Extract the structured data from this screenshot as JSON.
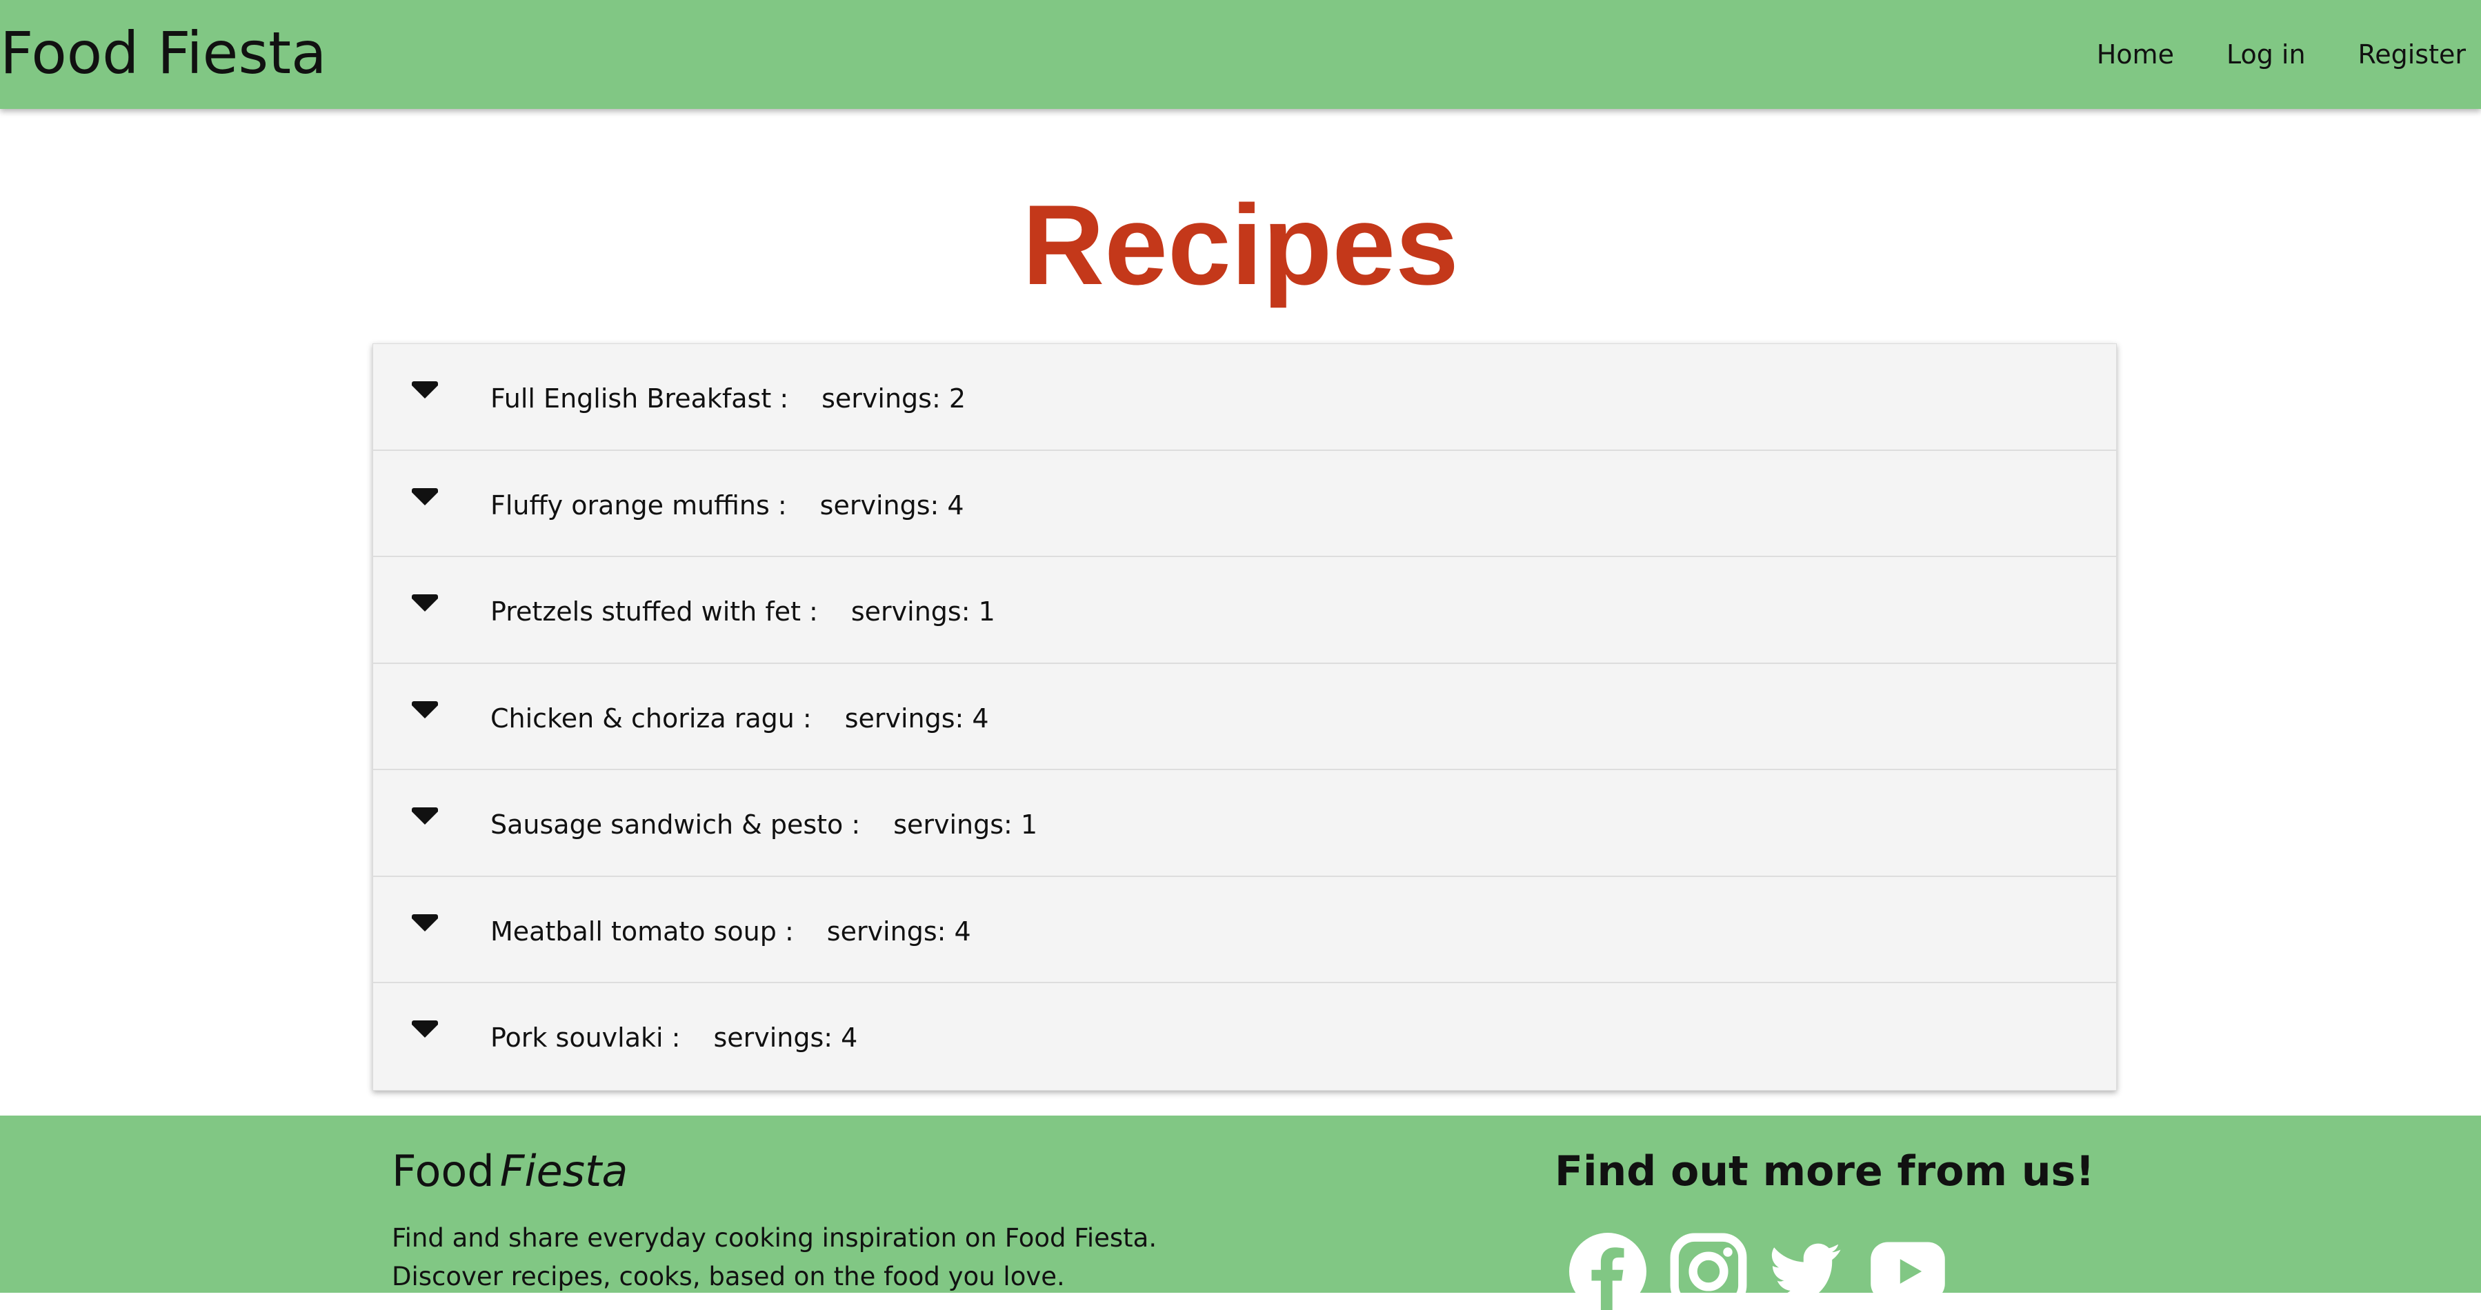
{
  "navbar": {
    "brand": "Food Fiesta",
    "links": [
      {
        "label": "Home"
      },
      {
        "label": "Log in"
      },
      {
        "label": "Register"
      }
    ]
  },
  "main": {
    "title": "Recipes",
    "recipes": [
      {
        "name": "Full English Breakfast :",
        "servings": "servings: 2"
      },
      {
        "name": "Fluffy orange muffins :",
        "servings": "servings: 4"
      },
      {
        "name": "Pretzels stuffed with fet :",
        "servings": "servings: 1"
      },
      {
        "name": "Chicken & choriza ragu :",
        "servings": "servings: 4"
      },
      {
        "name": "Sausage sandwich & pesto :",
        "servings": "servings: 1"
      },
      {
        "name": "Meatball tomato soup :",
        "servings": "servings: 4"
      },
      {
        "name": "Pork souvlaki :",
        "servings": "servings: 4"
      }
    ]
  },
  "footer": {
    "brand_main": "Food",
    "brand_accent": "Fiesta",
    "description": "Find and share everyday cooking inspiration on Food Fiesta. Discover recipes, cooks, based on the food you love.",
    "heading": "Find out more from us!",
    "social_icons": [
      "facebook-icon",
      "instagram-icon",
      "twitter-icon",
      "youtube-icon"
    ]
  },
  "colors": {
    "navbar_bg": "#81c784",
    "title": "#c4381a",
    "accordion_bg": "#f4f4f4"
  }
}
